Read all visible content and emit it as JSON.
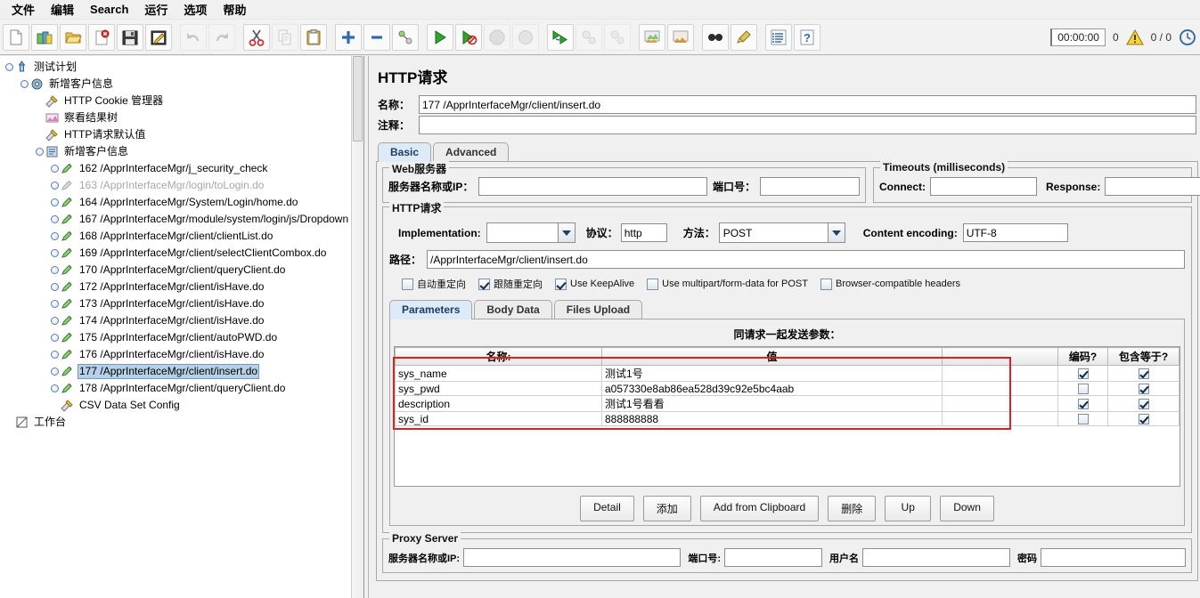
{
  "menu": {
    "items": [
      {
        "label": "文件",
        "name": "menu-file"
      },
      {
        "label": "编辑",
        "name": "menu-edit"
      },
      {
        "label": "Search",
        "name": "menu-search"
      },
      {
        "label": "运行",
        "name": "menu-run"
      },
      {
        "label": "选项",
        "name": "menu-options"
      },
      {
        "label": "帮助",
        "name": "menu-help"
      }
    ]
  },
  "toolbar": {
    "buttons": [
      {
        "icon": "new-file-icon",
        "label": "New"
      },
      {
        "icon": "templates-icon",
        "label": "Templates"
      },
      {
        "icon": "open-folder-icon",
        "label": "Open"
      },
      {
        "icon": "close-file-icon",
        "label": "Close"
      },
      {
        "icon": "save-icon",
        "label": "Save"
      },
      {
        "icon": "save-as-icon",
        "label": "Save As"
      },
      {
        "icon": "undo-icon",
        "label": "Undo"
      },
      {
        "icon": "redo-icon",
        "label": "Redo"
      },
      {
        "icon": "cut-icon",
        "label": "Cut"
      },
      {
        "icon": "copy-icon",
        "label": "Copy"
      },
      {
        "icon": "paste-icon",
        "label": "Paste"
      },
      {
        "icon": "expand-all-icon",
        "label": "Expand All"
      },
      {
        "icon": "collapse-all-icon",
        "label": "Collapse All"
      },
      {
        "icon": "toggle-icon",
        "label": "Toggle"
      },
      {
        "icon": "start-icon",
        "label": "Start"
      },
      {
        "icon": "start-no-pause-icon",
        "label": "Start no pauses"
      },
      {
        "icon": "stop-icon",
        "label": "Stop"
      },
      {
        "icon": "shutdown-icon",
        "label": "Shutdown"
      },
      {
        "icon": "remote-start-all-icon",
        "label": "Remote Start All"
      },
      {
        "icon": "remote-stop-all-icon",
        "label": "Remote Stop All"
      },
      {
        "icon": "remote-shutdown-all-icon",
        "label": "Remote Shutdown All"
      },
      {
        "icon": "clear-icon",
        "label": "Clear"
      },
      {
        "icon": "clear-all-icon",
        "label": "Clear All"
      },
      {
        "icon": "search-icon",
        "label": "Search"
      },
      {
        "icon": "search-reset-icon",
        "label": "Search Reset"
      },
      {
        "icon": "function-helper-icon",
        "label": "Function Helper"
      },
      {
        "icon": "help-icon",
        "label": "Help"
      }
    ],
    "status": {
      "timer": "00:00:00",
      "warning_count": "0",
      "warning_icon": "warning-triangle-icon",
      "threads": "0 / 0",
      "refresh_icon": "clock-refresh-icon"
    }
  },
  "tree": {
    "nodes": [
      {
        "label": "测试计划",
        "indent": 0,
        "icon": "test-plan-icon",
        "expander": true,
        "dim": false,
        "selected": false
      },
      {
        "label": "新增客户信息",
        "indent": 1,
        "icon": "thread-group-icon",
        "expander": true,
        "dim": false,
        "selected": false
      },
      {
        "label": "HTTP Cookie 管理器",
        "indent": 2,
        "icon": "config-element-icon",
        "expander": false,
        "dim": false,
        "selected": false
      },
      {
        "label": "察看结果树",
        "indent": 2,
        "icon": "view-results-tree-icon",
        "expander": false,
        "dim": false,
        "selected": false
      },
      {
        "label": "HTTP请求默认值",
        "indent": 2,
        "icon": "config-element-icon",
        "expander": false,
        "dim": false,
        "selected": false
      },
      {
        "label": "新增客户信息",
        "indent": 2,
        "icon": "controller-icon",
        "expander": true,
        "dim": false,
        "selected": false
      },
      {
        "label": "162 /ApprInterfaceMgr/j_security_check",
        "indent": 3,
        "icon": "http-sampler-icon",
        "expander": true,
        "dim": false,
        "selected": false
      },
      {
        "label": "163 /ApprInterfaceMgr/login/toLogin.do",
        "indent": 3,
        "icon": "http-sampler-disabled-icon",
        "expander": true,
        "dim": true,
        "selected": false
      },
      {
        "label": "164 /ApprInterfaceMgr/System/Login/home.do",
        "indent": 3,
        "icon": "http-sampler-icon",
        "expander": true,
        "dim": false,
        "selected": false
      },
      {
        "label": "167 /ApprInterfaceMgr/module/system/login/js/Dropdown",
        "indent": 3,
        "icon": "http-sampler-icon",
        "expander": true,
        "dim": false,
        "selected": false
      },
      {
        "label": "168 /ApprInterfaceMgr/client/clientList.do",
        "indent": 3,
        "icon": "http-sampler-icon",
        "expander": true,
        "dim": false,
        "selected": false
      },
      {
        "label": "169 /ApprInterfaceMgr/client/selectClientCombox.do",
        "indent": 3,
        "icon": "http-sampler-icon",
        "expander": true,
        "dim": false,
        "selected": false
      },
      {
        "label": "170 /ApprInterfaceMgr/client/queryClient.do",
        "indent": 3,
        "icon": "http-sampler-icon",
        "expander": true,
        "dim": false,
        "selected": false
      },
      {
        "label": "172 /ApprInterfaceMgr/client/isHave.do",
        "indent": 3,
        "icon": "http-sampler-icon",
        "expander": true,
        "dim": false,
        "selected": false
      },
      {
        "label": "173 /ApprInterfaceMgr/client/isHave.do",
        "indent": 3,
        "icon": "http-sampler-icon",
        "expander": true,
        "dim": false,
        "selected": false
      },
      {
        "label": "174 /ApprInterfaceMgr/client/isHave.do",
        "indent": 3,
        "icon": "http-sampler-icon",
        "expander": true,
        "dim": false,
        "selected": false
      },
      {
        "label": "175 /ApprInterfaceMgr/client/autoPWD.do",
        "indent": 3,
        "icon": "http-sampler-icon",
        "expander": true,
        "dim": false,
        "selected": false
      },
      {
        "label": "176 /ApprInterfaceMgr/client/isHave.do",
        "indent": 3,
        "icon": "http-sampler-icon",
        "expander": true,
        "dim": false,
        "selected": false
      },
      {
        "label": "177 /ApprInterfaceMgr/client/insert.do",
        "indent": 3,
        "icon": "http-sampler-icon",
        "expander": true,
        "dim": false,
        "selected": true
      },
      {
        "label": "178 /ApprInterfaceMgr/client/queryClient.do",
        "indent": 3,
        "icon": "http-sampler-icon",
        "expander": true,
        "dim": false,
        "selected": false
      },
      {
        "label": "CSV Data Set Config",
        "indent": 3,
        "icon": "config-element-icon",
        "expander": false,
        "dim": false,
        "selected": false
      },
      {
        "label": "工作台",
        "indent": 0,
        "icon": "workbench-icon",
        "expander": false,
        "dim": false,
        "selected": false
      }
    ]
  },
  "panel": {
    "title": "HTTP请求",
    "name_label": "名称：",
    "name_value": "177 /ApprInterfaceMgr/client/insert.do",
    "comment_label": "注释：",
    "comment_value": "",
    "tabs": [
      {
        "label": "Basic",
        "active": true
      },
      {
        "label": "Advanced",
        "active": false
      }
    ],
    "web_server": {
      "title": "Web服务器",
      "server_label": "服务器名称或IP：",
      "server_value": "",
      "port_label": "端口号：",
      "port_value": ""
    },
    "timeouts": {
      "title": "Timeouts (milliseconds)",
      "connect_label": "Connect:",
      "connect_value": "",
      "response_label": "Response:",
      "response_value": ""
    },
    "http_request": {
      "title": "HTTP请求",
      "implementation_label": "Implementation:",
      "implementation_value": "",
      "protocol_label": "协议：",
      "protocol_value": "http",
      "method_label": "方法：",
      "method_value": "POST",
      "content_encoding_label": "Content encoding:",
      "content_encoding_value": "UTF-8",
      "path_label": "路径：",
      "path_value": "/ApprInterfaceMgr/client/insert.do",
      "checkboxes": [
        {
          "label": "自动重定向",
          "checked": false,
          "name": "auto-redirect-checkbox"
        },
        {
          "label": "跟随重定向",
          "checked": true,
          "name": "follow-redirect-checkbox"
        },
        {
          "label": "Use KeepAlive",
          "checked": true,
          "name": "keepalive-checkbox"
        },
        {
          "label": "Use multipart/form-data for POST",
          "checked": false,
          "name": "multipart-checkbox"
        },
        {
          "label": "Browser-compatible headers",
          "checked": false,
          "name": "browser-compatible-checkbox"
        }
      ]
    },
    "param_tabs": [
      {
        "label": "Parameters",
        "active": true
      },
      {
        "label": "Body Data",
        "active": false
      },
      {
        "label": "Files Upload",
        "active": false
      }
    ],
    "params": {
      "caption": "同请求一起发送参数：",
      "columns": [
        "名称:",
        "值",
        "",
        "编码?",
        "包含等于?"
      ],
      "rows": [
        {
          "name": "sys_name",
          "value": "测试1号",
          "encode": true,
          "include_equals": true
        },
        {
          "name": "sys_pwd",
          "value": "a057330e8ab86ea528d39c92e5bc4aab",
          "encode": false,
          "include_equals": true
        },
        {
          "name": "description",
          "value": "测试1号看看",
          "encode": true,
          "include_equals": true
        },
        {
          "name": "sys_id",
          "value": "888888888",
          "encode": false,
          "include_equals": true
        }
      ],
      "highlight_color": "#e02020"
    },
    "buttons": [
      {
        "label": "Detail",
        "name": "detail-button"
      },
      {
        "label": "添加",
        "name": "add-button"
      },
      {
        "label": "Add from Clipboard",
        "name": "add-from-clipboard-button"
      },
      {
        "label": "删除",
        "name": "delete-button"
      },
      {
        "label": "Up",
        "name": "up-button"
      },
      {
        "label": "Down",
        "name": "down-button"
      }
    ],
    "proxy": {
      "title": "Proxy Server",
      "server_label": "服务器名称或IP:",
      "server_value": "",
      "port_label": "端口号:",
      "port_value": "",
      "username_label": "用户名",
      "username_value": "",
      "password_label": "密码",
      "password_value": ""
    }
  }
}
